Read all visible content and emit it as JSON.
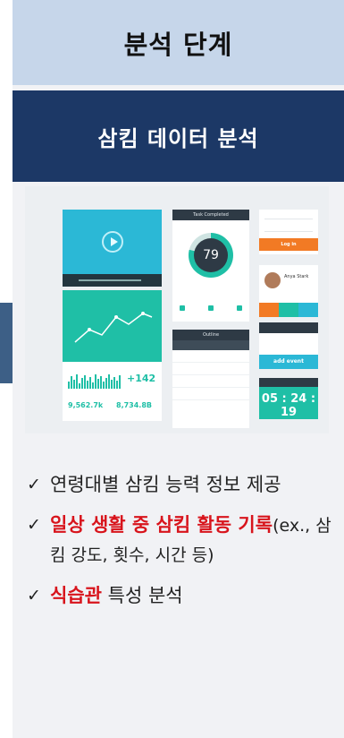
{
  "header": {
    "title": "분석 단계"
  },
  "subheader": {
    "title": "삼킴 데이터 분석"
  },
  "mockup": {
    "task_title": "Task Completed",
    "progress_value": "79",
    "progress_fraction": 0.79,
    "login_button": "Log in",
    "profile_name": "Anya Stark",
    "inbox_title": "Outline",
    "add_event_button": "add event",
    "countdown": "05 : 24 : 19",
    "stat_change": "+142",
    "stat_left": "9,562.7k",
    "stat_right": "8,734.8B"
  },
  "bullets": [
    {
      "check": "✓",
      "text": "연령대별 삼킴 능력 정보 제공"
    },
    {
      "check": "✓",
      "highlight": "일상 생활 중 삼킴 활동 기록",
      "rest": "(ex., 삼킴 강도, 횟수, 시간 등)"
    },
    {
      "check": "✓",
      "highlight": "식습관",
      "rest": " 특성 분석"
    }
  ],
  "colors": {
    "header_bg": "#c6d6ea",
    "subheader_bg": "#1c3866",
    "highlight": "#d8141c",
    "teal": "#1fbfa6",
    "orange": "#f27a24"
  }
}
